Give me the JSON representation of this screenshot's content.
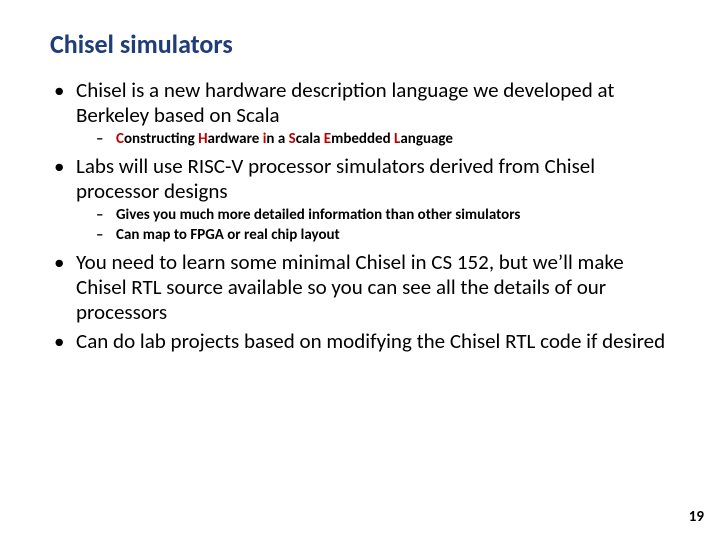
{
  "title": "Chisel simulators",
  "bullets": {
    "b1": "Chisel is a new hardware description language we developed at Berkeley based on Scala",
    "b1_sub": {
      "pre_c": "C",
      "post_c": "onstructing ",
      "pre_h": "H",
      "post_h": "ardware ",
      "pre_i": "i",
      "post_i": "n a ",
      "pre_s": "S",
      "post_s": "cala ",
      "pre_e": "E",
      "post_e": "mbedded ",
      "pre_l": "L",
      "post_l": "anguage"
    },
    "b2": "Labs will use RISC-V processor simulators derived from Chisel processor designs",
    "b2_sub1": "Gives you much more detailed information than other simulators",
    "b2_sub2": "Can map to FPGA or real chip layout",
    "b3": "You need to learn some minimal Chisel in CS 152, but we’ll make Chisel RTL source available so you can see all the details of our processors",
    "b4": "Can do lab projects based on modifying the Chisel RTL code if desired"
  },
  "page_number": "19"
}
